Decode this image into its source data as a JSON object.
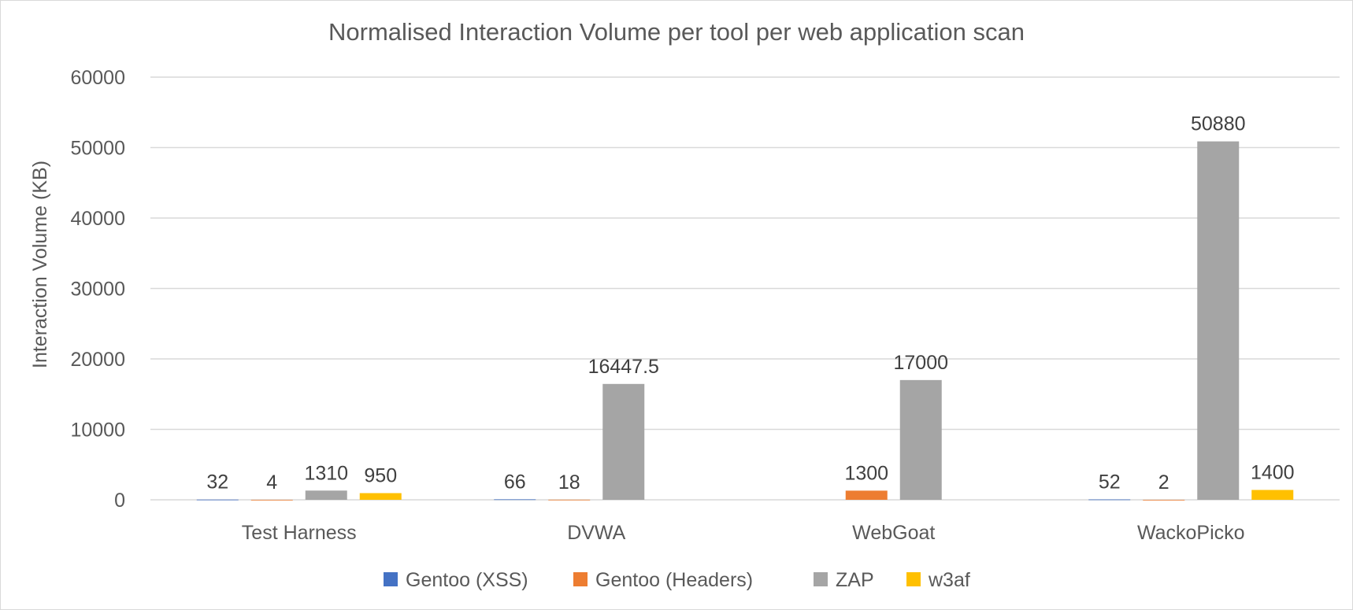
{
  "chart_data": {
    "type": "bar",
    "title": "Normalised Interaction Volume per tool per web application scan",
    "xlabel": "",
    "ylabel": "Interaction Volume (KB)",
    "ylim": [
      0,
      60000
    ],
    "yticks": [
      0,
      10000,
      20000,
      30000,
      40000,
      50000,
      60000
    ],
    "grid": true,
    "legend_position": "bottom",
    "categories": [
      "Test Harness",
      "DVWA",
      "WebGoat",
      "WackoPicko"
    ],
    "series": [
      {
        "name": "Gentoo (XSS)",
        "color": "#4472C4",
        "values": [
          32,
          66,
          null,
          52
        ],
        "labels": [
          "32",
          "66",
          null,
          "52"
        ]
      },
      {
        "name": "Gentoo (Headers)",
        "color": "#ED7D31",
        "values": [
          4,
          18,
          1300,
          2
        ],
        "labels": [
          "4",
          "18",
          "1300",
          "2"
        ]
      },
      {
        "name": "ZAP",
        "color": "#A5A5A5",
        "values": [
          1310,
          16447.5,
          17000,
          50880
        ],
        "labels": [
          "1310",
          "16447.5",
          "17000",
          "50880"
        ]
      },
      {
        "name": "w3af",
        "color": "#FFC000",
        "values": [
          950,
          null,
          null,
          1400
        ],
        "labels": [
          "950",
          null,
          null,
          "1400"
        ]
      }
    ]
  }
}
